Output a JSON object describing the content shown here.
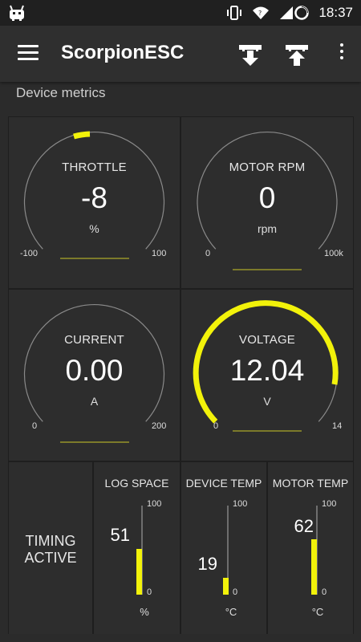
{
  "status_bar": {
    "time": "18:37",
    "icons": [
      "android-notification-icon",
      "vibrate-icon",
      "wifi-icon",
      "signal-icon",
      "battery-icon"
    ]
  },
  "app_bar": {
    "title": "ScorpionESC",
    "actions": [
      "download-icon",
      "upload-icon",
      "more-vert-icon"
    ]
  },
  "section_label": "Device metrics",
  "accent_color": "#f2f20a",
  "gauges": [
    {
      "title": "THROTTLE",
      "value": "-8",
      "unit": "%",
      "min": "-100",
      "max": "100",
      "value_num": -8,
      "range": [
        -100,
        100
      ]
    },
    {
      "title": "MOTOR RPM",
      "value": "0",
      "unit": "rpm",
      "min": "0",
      "max": "100k",
      "value_num": 0,
      "range": [
        0,
        100
      ]
    },
    {
      "title": "CURRENT",
      "value": "0.00",
      "unit": "A",
      "min": "0",
      "max": "200",
      "value_num": 0,
      "range": [
        0,
        200
      ]
    },
    {
      "title": "VOLTAGE",
      "value": "12.04",
      "unit": "V",
      "min": "0",
      "max": "14",
      "value_num": 12.04,
      "range": [
        0,
        14
      ]
    }
  ],
  "timing": {
    "line1": "TIMING",
    "line2": "ACTIVE"
  },
  "bars": [
    {
      "title": "LOG SPACE",
      "value": "51",
      "unit": "%",
      "max": "100",
      "min": "0",
      "value_num": 51
    },
    {
      "title": "DEVICE TEMP",
      "value": "19",
      "unit": "°C",
      "max": "100",
      "min": "0",
      "value_num": 19
    },
    {
      "title": "MOTOR TEMP",
      "value": "62",
      "unit": "°C",
      "max": "100",
      "min": "0",
      "value_num": 62
    }
  ]
}
